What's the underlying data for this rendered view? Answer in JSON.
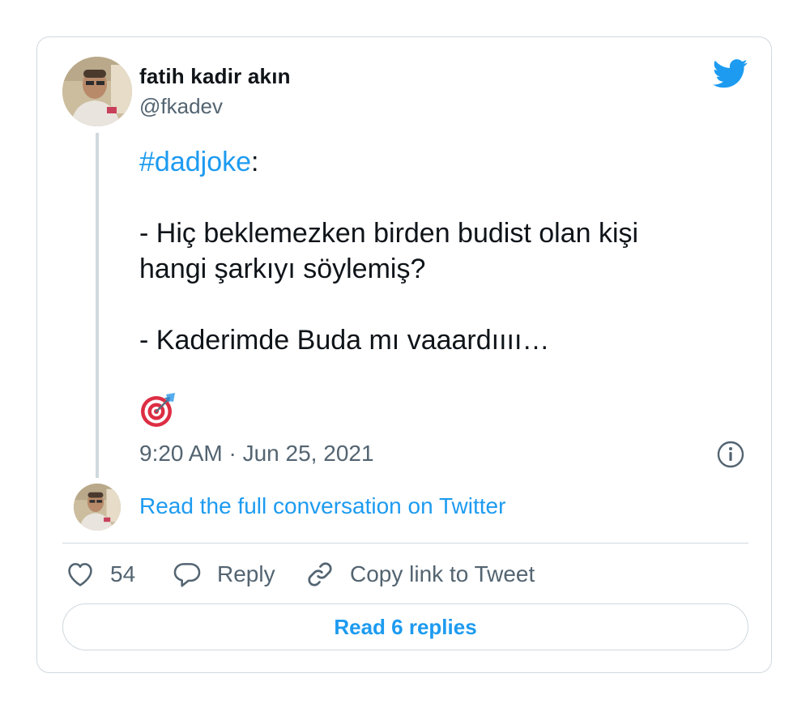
{
  "author": {
    "name": "fatih kadir akın",
    "handle": "@fkadev"
  },
  "tweet": {
    "hashtag": "#dadjoke",
    "hashtag_suffix": ":",
    "lines": [
      "- Hiç beklemezken birden budist olan kişi",
      "hangi şarkıyı söylemiş?",
      "- Kaderimde Buda mı vaaardıııı…"
    ],
    "emoji": "direct-hit-target-emoji",
    "timestamp": "9:20 AM · Jun 25, 2021"
  },
  "links": {
    "read_conversation": "Read the full conversation on Twitter",
    "read_replies": "Read 6 replies"
  },
  "actions": {
    "like_count": "54",
    "reply_label": "Reply",
    "copy_label": "Copy link to Tweet"
  },
  "icons": {
    "brand": "twitter-bird-icon",
    "info": "info-icon",
    "like": "heart-icon",
    "reply": "speech-bubble-icon",
    "copy": "link-icon"
  },
  "colors": {
    "accent": "#1d9bf0",
    "text": "#0f1419",
    "muted": "#536471",
    "border": "#cfd9de"
  }
}
